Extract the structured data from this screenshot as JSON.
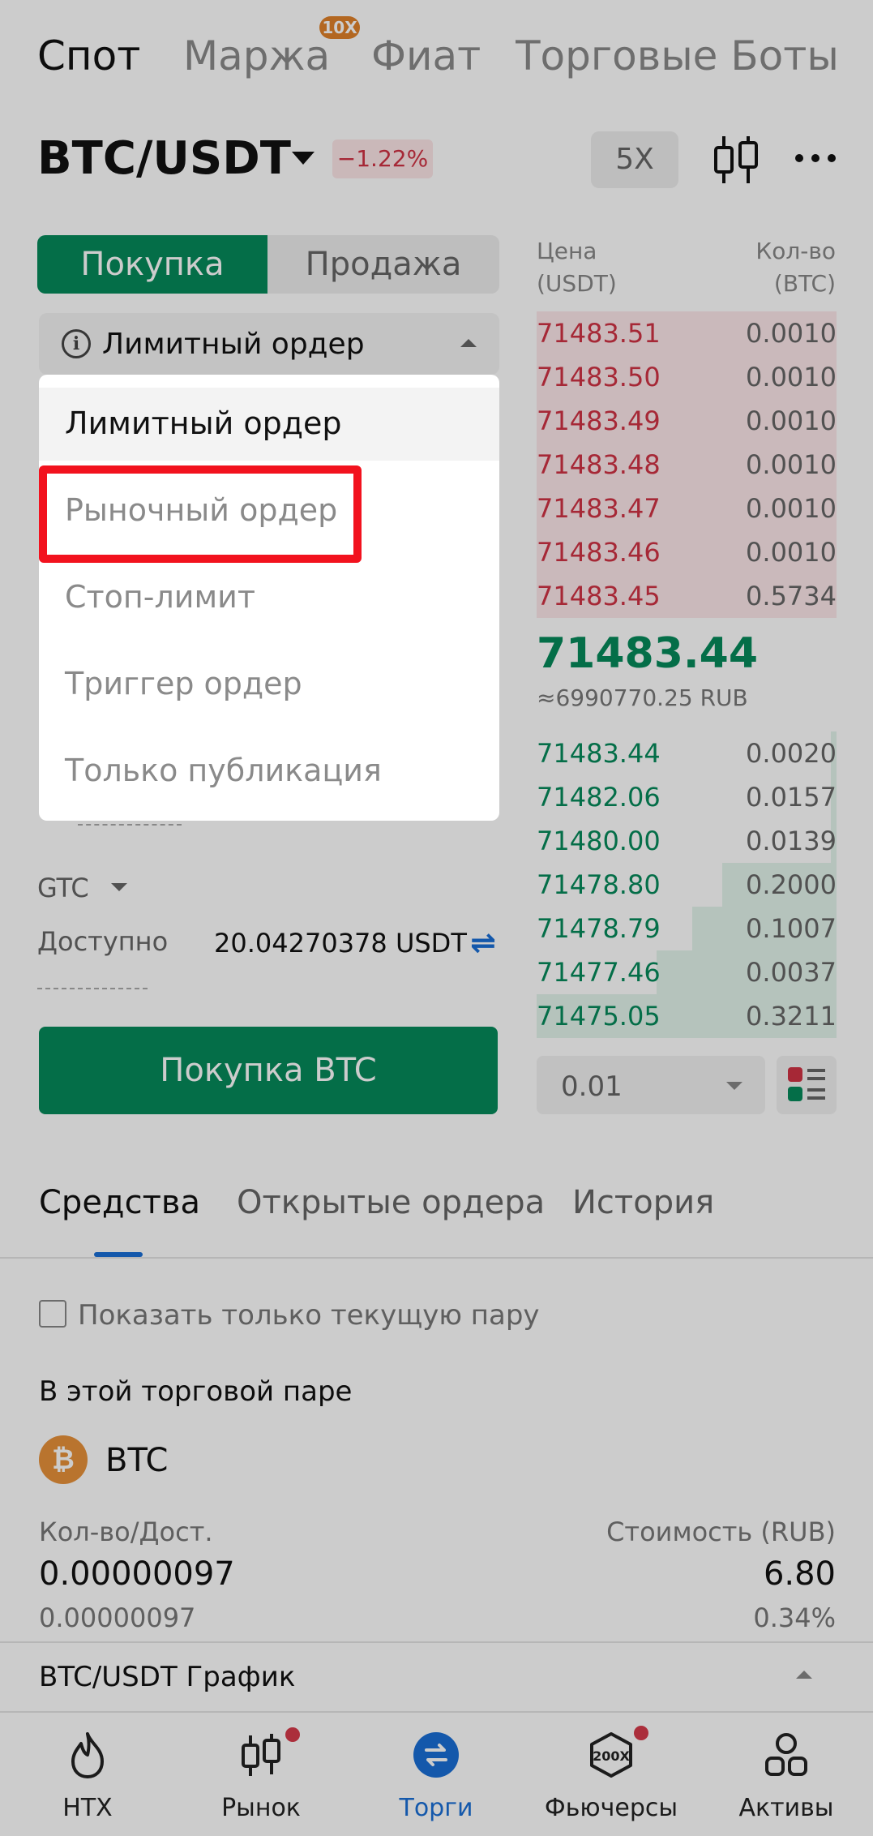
{
  "top_tabs": {
    "items": [
      "Спот",
      "Маржа",
      "Фиат",
      "Торговые Боты"
    ],
    "margin_badge": "10X"
  },
  "pair": {
    "title": "BTC/USDT",
    "change": "−1.22%",
    "leverage": "5X"
  },
  "trade": {
    "buy_tab": "Покупка",
    "sell_tab": "Продажа",
    "order_type": "Лимитный ордер",
    "info_glyph": "i",
    "time_in_force": "GTC",
    "available_label": "Доступно",
    "available_value": "20.04270378 USDT",
    "swap_glyph": "⇌",
    "buy_button": "Покупка BTC"
  },
  "dropdown": {
    "items": [
      "Лимитный ордер",
      "Рыночный ордер",
      "Стоп-лимит",
      "Триггер ордер",
      "Только публикация"
    ],
    "selected_index": 0,
    "highlighted_index": 1
  },
  "order_book": {
    "price_header": "Цена",
    "price_unit": "(USDT)",
    "qty_header": "Кол-во",
    "qty_unit": "(BTC)",
    "asks": [
      {
        "price": "71483.51",
        "qty": "0.0010"
      },
      {
        "price": "71483.50",
        "qty": "0.0010"
      },
      {
        "price": "71483.49",
        "qty": "0.0010"
      },
      {
        "price": "71483.48",
        "qty": "0.0010"
      },
      {
        "price": "71483.47",
        "qty": "0.0010"
      },
      {
        "price": "71483.46",
        "qty": "0.0010"
      },
      {
        "price": "71483.45",
        "qty": "0.5734"
      }
    ],
    "last_price": "71483.44",
    "last_price_rub": "≈6990770.25 RUB",
    "bids": [
      {
        "price": "71483.44",
        "qty": "0.0020",
        "depth": 0.02
      },
      {
        "price": "71482.06",
        "qty": "0.0157",
        "depth": 0.02
      },
      {
        "price": "71480.00",
        "qty": "0.0139",
        "depth": 0.02
      },
      {
        "price": "71478.80",
        "qty": "0.2000",
        "depth": 0.38
      },
      {
        "price": "71478.79",
        "qty": "0.1007",
        "depth": 0.48
      },
      {
        "price": "71477.46",
        "qty": "0.0037",
        "depth": 0.6
      },
      {
        "price": "71475.05",
        "qty": "0.3211",
        "depth": 1.0
      }
    ],
    "depth_value": "0.01",
    "colors": {
      "ask": "#d03244",
      "bid": "#068a5b",
      "ask_bg": "#fde8ea",
      "bid_bg": "#e3f4ec"
    }
  },
  "assets": {
    "tabs": [
      "Средства",
      "Открытые ордера",
      "История"
    ],
    "filter_label": "Показать только текущую пару",
    "section_title": "В этой торговой паре",
    "coin_glyph": "₿",
    "coin": "BTC",
    "qty_header": "Кол-во/Дост.",
    "value_header": "Стоимость (RUB)",
    "qty_value": "0.00000097",
    "qty_available": "0.00000097",
    "value_rub": "6.80",
    "share": "0.34%",
    "chart_title": "BTC/USDT График"
  },
  "nav": {
    "items": [
      "HTX",
      "Рынок",
      "Торги",
      "Фьючерсы",
      "Активы"
    ],
    "active_index": 2,
    "futures_icon_text": "200X",
    "colors": {
      "active": "#1a6fd6",
      "dot": "#d63a4a"
    }
  }
}
